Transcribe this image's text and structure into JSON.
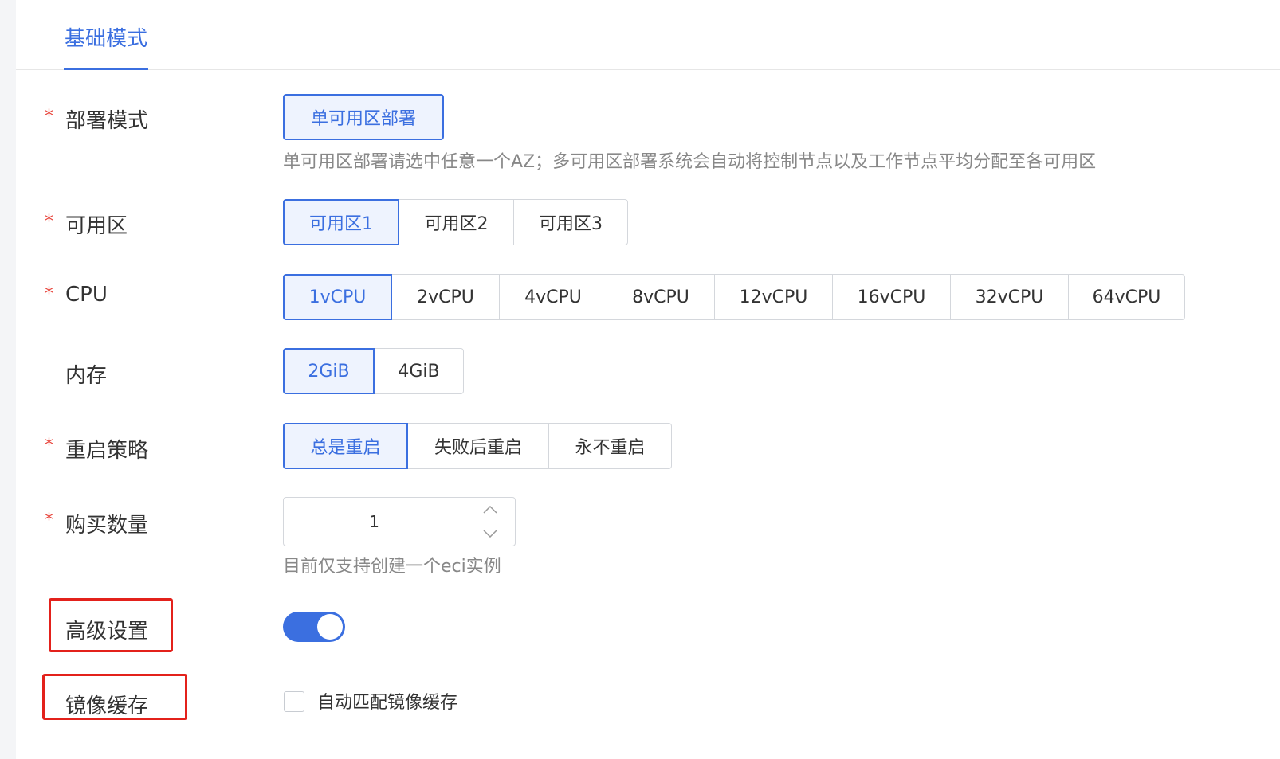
{
  "tabs": {
    "active": "基础模式"
  },
  "deploy_mode": {
    "label": "部署模式",
    "required": "*",
    "option": "单可用区部署",
    "hint": "单可用区部署请选中任意一个AZ；多可用区部署系统会自动将控制节点以及工作节点平均分配至各可用区"
  },
  "zone": {
    "label": "可用区",
    "required": "*",
    "options": [
      "可用区1",
      "可用区2",
      "可用区3"
    ],
    "selected": "可用区1"
  },
  "cpu": {
    "label": "CPU",
    "required": "*",
    "options": [
      "1vCPU",
      "2vCPU",
      "4vCPU",
      "8vCPU",
      "12vCPU",
      "16vCPU",
      "32vCPU",
      "64vCPU"
    ],
    "selected": "1vCPU"
  },
  "memory": {
    "label": "内存",
    "options": [
      "2GiB",
      "4GiB"
    ],
    "selected": "2GiB"
  },
  "restart_policy": {
    "label": "重启策略",
    "required": "*",
    "options": [
      "总是重启",
      "失败后重启",
      "永不重启"
    ],
    "selected": "总是重启"
  },
  "quantity": {
    "label": "购买数量",
    "required": "*",
    "value": "1",
    "hint": "目前仅支持创建一个eci实例"
  },
  "advanced": {
    "label": "高级设置",
    "enabled": true
  },
  "image_cache": {
    "label": "镜像缓存",
    "checkbox_label": "自动匹配镜像缓存",
    "checked": false
  },
  "colors": {
    "accent": "#3b6fe0",
    "required": "#e8453c",
    "highlight_box": "#e3211b"
  }
}
